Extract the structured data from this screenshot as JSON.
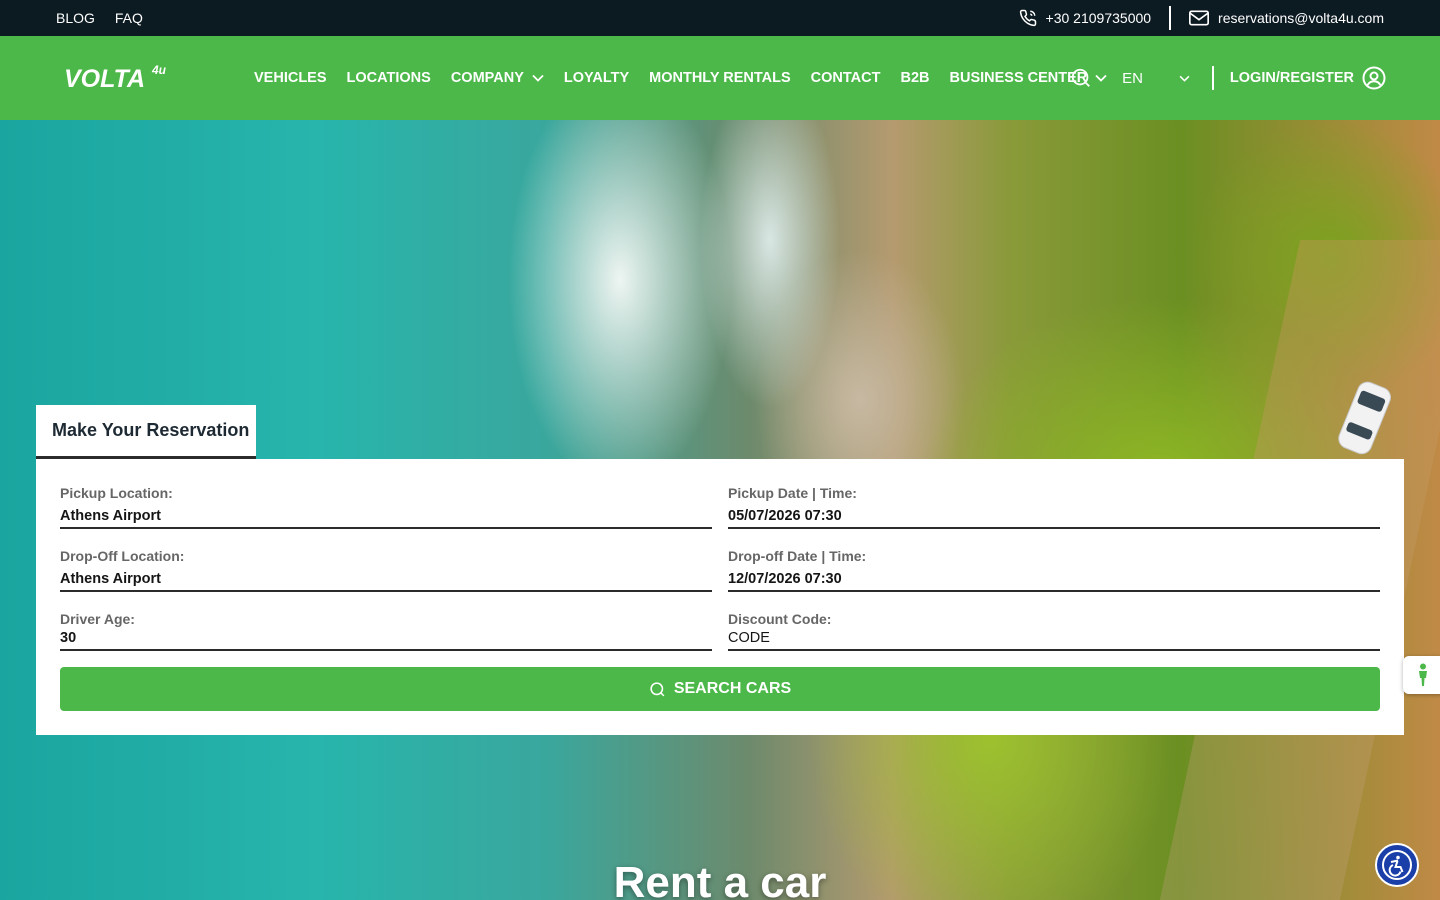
{
  "topbar": {
    "links": [
      "BLOG",
      "FAQ"
    ],
    "phone": "+30 2109735000",
    "email": "reservations@volta4u.com"
  },
  "nav": {
    "logo_text": "VOLTA",
    "logo_sup": "4u",
    "items": [
      "VEHICLES",
      "LOCATIONS",
      "COMPANY",
      "LOYALTY",
      "MONTHLY RENTALS",
      "CONTACT",
      "B2B",
      "BUSINESS CENTER"
    ],
    "language": "EN",
    "login_label": "LOGIN/REGISTER"
  },
  "reservation": {
    "tab_title": "Make Your Reservation",
    "pickup_location_label": "Pickup Location:",
    "pickup_location": "Athens Airport",
    "pickup_datetime_label": "Pickup Date | Time:",
    "pickup_datetime": "05/07/2026 07:30",
    "dropoff_location_label": "Drop-Off Location:",
    "dropoff_location": "Athens Airport",
    "dropoff_datetime_label": "Drop-off Date | Time:",
    "dropoff_datetime": "12/07/2026 07:30",
    "driver_age_label": "Driver Age:",
    "driver_age": "30",
    "discount_label": "Discount Code:",
    "discount_code": "CODE",
    "search_label": "SEARCH CARS"
  },
  "hero": {
    "title": "Rent a car"
  },
  "colors": {
    "brand_green": "#4cb849",
    "topbar_bg": "#0c1a22",
    "accessibility_blue": "#1a3fa8"
  }
}
